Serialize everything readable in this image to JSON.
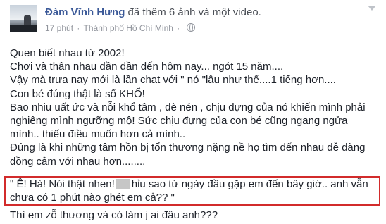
{
  "post": {
    "author": "Đàm Vĩnh Hưng",
    "action": "đã thêm 6 ảnh và một video.",
    "time": "17 phút",
    "separator": "·",
    "location": "Thành phố Hồ Chí Minh",
    "privacy_icon": "globe-icon",
    "menu_icon": "chevron-down-icon",
    "lines": [
      "Quen biết nhau từ 2002!",
      "Chơi và thân nhau dần dần đến hôm nay... ngót 15 năm....",
      "Vậy mà trưa nay mới là lần chat với \" nó \"lâu như thế....1 tiếng hơn....",
      "Con bé đúng thật là số KHỔ!",
      "Bao nhiu uất ức và nỗi khổ tâm , đè nén , chịu đựng của nó khiến mình phải",
      "nghiêng mình ngưỡng mộ! Sức chịu đựng của con bé cũng ngang ngửa",
      "mình.. thiếu điều muốn hơn cả mình..",
      "Đúng là khi những tâm hồn bị tổn thương nặng nề họ tìm đến nhau dễ dàng",
      "đồng cảm với nhau hơn........"
    ],
    "quote": {
      "line1_start": "\" Ê! Hà! Nói thật nhen!",
      "line1_end": "hỉu sao từ ngày đầu gặp em đến bây giờ.. anh vẫn",
      "line2": "chưa có 1 phút nào ghét em cả?? \""
    },
    "last_line": "Thì em zỗ thương và có làm j ai đâu anh???"
  }
}
